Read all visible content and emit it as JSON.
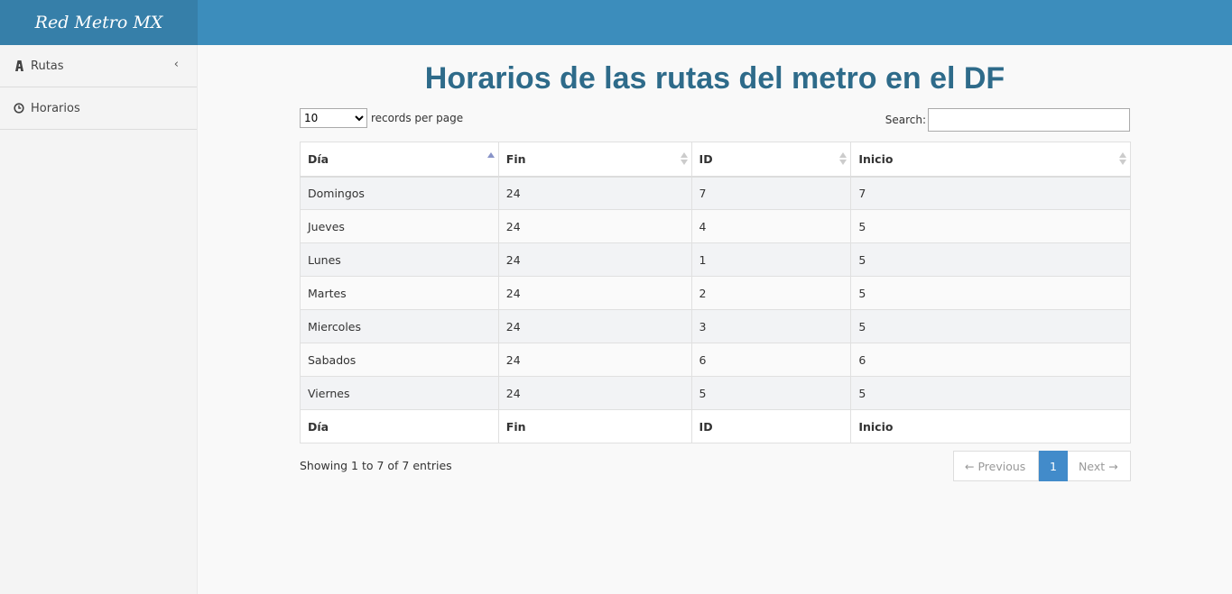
{
  "brand": "Red Metro MX",
  "sidebar": {
    "items": [
      {
        "label": "Rutas",
        "icon": "road-icon"
      },
      {
        "label": "Horarios",
        "icon": "clock-icon"
      }
    ]
  },
  "main": {
    "title": "Horarios de las rutas del metro en el DF",
    "length": {
      "selected": "10",
      "label": "records per page"
    },
    "search": {
      "label": "Search:",
      "value": ""
    },
    "table": {
      "headers": [
        "Día",
        "Fin",
        "ID",
        "Inicio"
      ],
      "rows": [
        [
          "Domingos",
          "24",
          "7",
          "7"
        ],
        [
          "Jueves",
          "24",
          "4",
          "5"
        ],
        [
          "Lunes",
          "24",
          "1",
          "5"
        ],
        [
          "Martes",
          "24",
          "2",
          "5"
        ],
        [
          "Miercoles",
          "24",
          "3",
          "5"
        ],
        [
          "Sabados",
          "24",
          "6",
          "6"
        ],
        [
          "Viernes",
          "24",
          "5",
          "5"
        ]
      ]
    },
    "info": "Showing 1 to 7 of 7 entries",
    "pagination": {
      "previous": "← Previous",
      "current": "1",
      "next": "Next →"
    }
  },
  "colors": {
    "header": "#3c8dbc",
    "brand_bg": "#367fa9",
    "title": "#2e6b8a",
    "active_page": "#428bca"
  }
}
